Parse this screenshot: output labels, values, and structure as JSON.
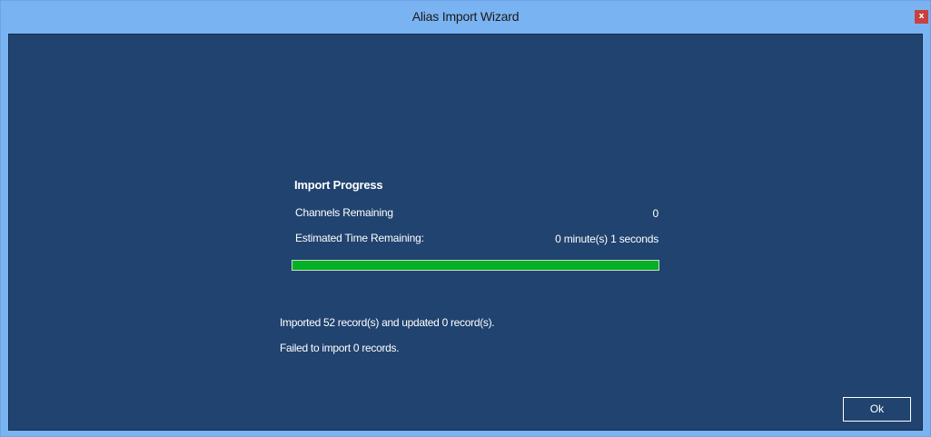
{
  "window": {
    "title": "Alias Import Wizard",
    "close_label": "x"
  },
  "progress": {
    "heading": "Import Progress",
    "channels_label": "Channels Remaining",
    "channels_value": "0",
    "time_label": "Estimated Time Remaining:",
    "time_value": "0 minute(s) 1 seconds",
    "fraction": 1.0
  },
  "status": {
    "imported": "Imported 52 record(s) and updated 0 record(s).",
    "failed": "Failed to import 0 records."
  },
  "buttons": {
    "ok_label": "Ok"
  },
  "colors": {
    "title_bar": "#7ab3f2",
    "panel_background": "#20436f",
    "progress_fill": "#06b025",
    "close_button": "#c8413f"
  }
}
